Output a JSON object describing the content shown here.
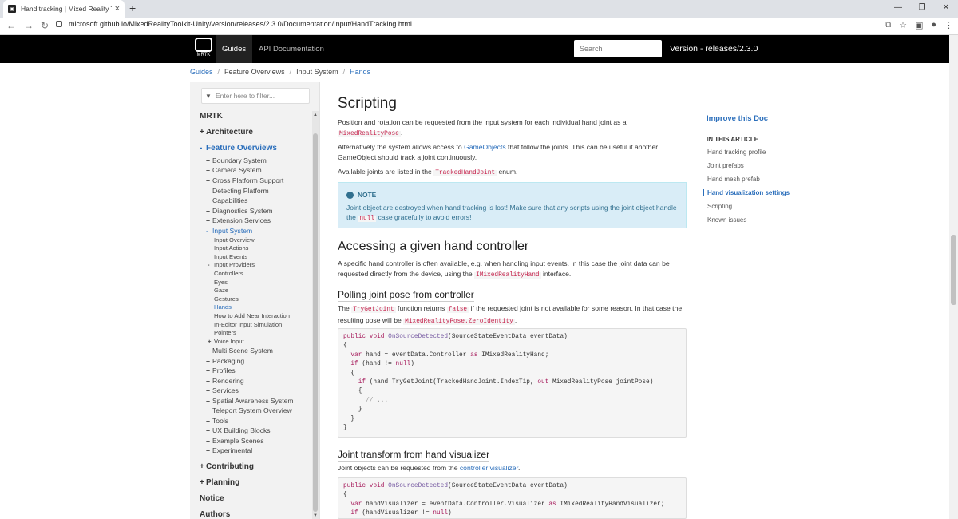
{
  "browser": {
    "tab_title": "Hand tracking | Mixed Reality To",
    "url": "microsoft.github.io/MixedRealityToolkit-Unity/version/releases/2.3.0/Documentation/Input/HandTracking.html"
  },
  "header": {
    "logo_text": "MRTK",
    "nav_guides": "Guides",
    "nav_api": "API Documentation",
    "search_placeholder": "Search",
    "version": "Version - releases/2.3.0"
  },
  "breadcrumb": [
    "Guides",
    "Feature Overviews",
    "Input System",
    "Hands"
  ],
  "sidebar": {
    "filter_placeholder": "Enter here to filter...",
    "items": [
      {
        "label": "MRTK",
        "level": 0,
        "prefix": ""
      },
      {
        "label": "Architecture",
        "level": 0,
        "prefix": "+"
      },
      {
        "label": "Feature Overviews",
        "level": 0,
        "prefix": "-",
        "active": true
      },
      {
        "label": "Boundary System",
        "level": 1,
        "prefix": "+"
      },
      {
        "label": "Camera System",
        "level": 1,
        "prefix": "+"
      },
      {
        "label": "Cross Platform Support",
        "level": 1,
        "prefix": "+"
      },
      {
        "label": "Detecting Platform",
        "level": 1,
        "prefix": ""
      },
      {
        "label": "Capabilities",
        "level": 1,
        "prefix": ""
      },
      {
        "label": "Diagnostics System",
        "level": 1,
        "prefix": "+"
      },
      {
        "label": "Extension Services",
        "level": 1,
        "prefix": "+"
      },
      {
        "label": "Input System",
        "level": 1,
        "prefix": "-",
        "active": true
      },
      {
        "label": "Input Overview",
        "level": 2,
        "prefix": ""
      },
      {
        "label": "Input Actions",
        "level": 2,
        "prefix": ""
      },
      {
        "label": "Input Events",
        "level": 2,
        "prefix": ""
      },
      {
        "label": "Input Providers",
        "level": 2,
        "prefix": "-"
      },
      {
        "label": "Controllers",
        "level": 2,
        "prefix": ""
      },
      {
        "label": "Eyes",
        "level": 2,
        "prefix": ""
      },
      {
        "label": "Gaze",
        "level": 2,
        "prefix": ""
      },
      {
        "label": "Gestures",
        "level": 2,
        "prefix": ""
      },
      {
        "label": "Hands",
        "level": 2,
        "prefix": "",
        "active": true
      },
      {
        "label": "How to Add Near Interaction",
        "level": 2,
        "prefix": ""
      },
      {
        "label": "In-Editor Input Simulation",
        "level": 2,
        "prefix": ""
      },
      {
        "label": "Pointers",
        "level": 2,
        "prefix": ""
      },
      {
        "label": "Voice Input",
        "level": 2,
        "prefix": "+"
      },
      {
        "label": "Multi Scene System",
        "level": 1,
        "prefix": "+"
      },
      {
        "label": "Packaging",
        "level": 1,
        "prefix": "+"
      },
      {
        "label": "Profiles",
        "level": 1,
        "prefix": "+"
      },
      {
        "label": "Rendering",
        "level": 1,
        "prefix": "+"
      },
      {
        "label": "Services",
        "level": 1,
        "prefix": "+"
      },
      {
        "label": "Spatial Awareness System",
        "level": 1,
        "prefix": "+"
      },
      {
        "label": "Teleport System Overview",
        "level": 1,
        "prefix": ""
      },
      {
        "label": "Tools",
        "level": 1,
        "prefix": "+"
      },
      {
        "label": "UX Building Blocks",
        "level": 1,
        "prefix": "+"
      },
      {
        "label": "Example Scenes",
        "level": 1,
        "prefix": "+"
      },
      {
        "label": "Experimental",
        "level": 1,
        "prefix": "+"
      },
      {
        "label": "Contributing",
        "level": 0,
        "prefix": "+"
      },
      {
        "label": "Planning",
        "level": 0,
        "prefix": "+"
      },
      {
        "label": "Notice",
        "level": 0,
        "prefix": ""
      },
      {
        "label": "Authors",
        "level": 0,
        "prefix": ""
      }
    ]
  },
  "content": {
    "h_scripting": "Scripting",
    "p1_a": "Position and rotation can be requested from the input system for each individual hand joint as a ",
    "p1_code": "MixedRealityPose",
    "p1_b": ".",
    "p2_a": "Alternatively the system allows access to ",
    "p2_link": "GameObjects",
    "p2_b": " that follow the joints. This can be useful if another GameObject should track a joint continuously.",
    "p3_a": "Available joints are listed in the ",
    "p3_code": "TrackedHandJoint",
    "p3_b": " enum.",
    "note_title": "NOTE",
    "note_a": "Joint object are destroyed when hand tracking is lost! Make sure that any scripts using the joint object handle the ",
    "note_code": "null",
    "note_b": " case gracefully to avoid errors!",
    "h_accessing": "Accessing a given hand controller",
    "p4_a": "A specific hand controller is often available, e.g. when handling input events. In this case the joint data can be requested directly from the device, using the ",
    "p4_code": "IMixedRealityHand",
    "p4_b": " interface.",
    "h_polling": "Polling joint pose from controller",
    "p5_a": "The ",
    "p5_code1": "TryGetJoint",
    "p5_b": " function returns ",
    "p5_code2": "false",
    "p5_c": " if the requested joint is not available for some reason. In that case the resulting pose will be ",
    "p5_code3": "MixedRealityPose.ZeroIdentity",
    "p5_d": ".",
    "code1": [
      "public void OnSourceDetected(SourceStateEventData eventData)",
      "{",
      "  var hand = eventData.Controller as IMixedRealityHand;",
      "  if (hand != null)",
      "  {",
      "    if (hand.TryGetJoint(TrackedHandJoint.IndexTip, out MixedRealityPose jointPose)",
      "    {",
      "      // ...",
      "    }",
      "  }",
      "}"
    ],
    "h_joint_transform": "Joint transform from hand visualizer",
    "p6_a": "Joint objects can be requested from the ",
    "p6_link": "controller visualizer",
    "p6_b": ".",
    "code2": [
      "public void OnSourceDetected(SourceStateEventData eventData)",
      "{",
      "  var handVisualizer = eventData.Controller.Visualizer as IMixedRealityHandVisualizer;",
      "  if (handVisualizer != null)"
    ]
  },
  "aside": {
    "improve": "Improve this Doc",
    "in_this_article": "IN THIS ARTICLE",
    "items": [
      {
        "label": "Hand tracking profile"
      },
      {
        "label": "Joint prefabs"
      },
      {
        "label": "Hand mesh prefab"
      },
      {
        "label": "Hand visualization settings",
        "active": true
      },
      {
        "label": "Scripting"
      },
      {
        "label": "Known issues"
      }
    ]
  }
}
